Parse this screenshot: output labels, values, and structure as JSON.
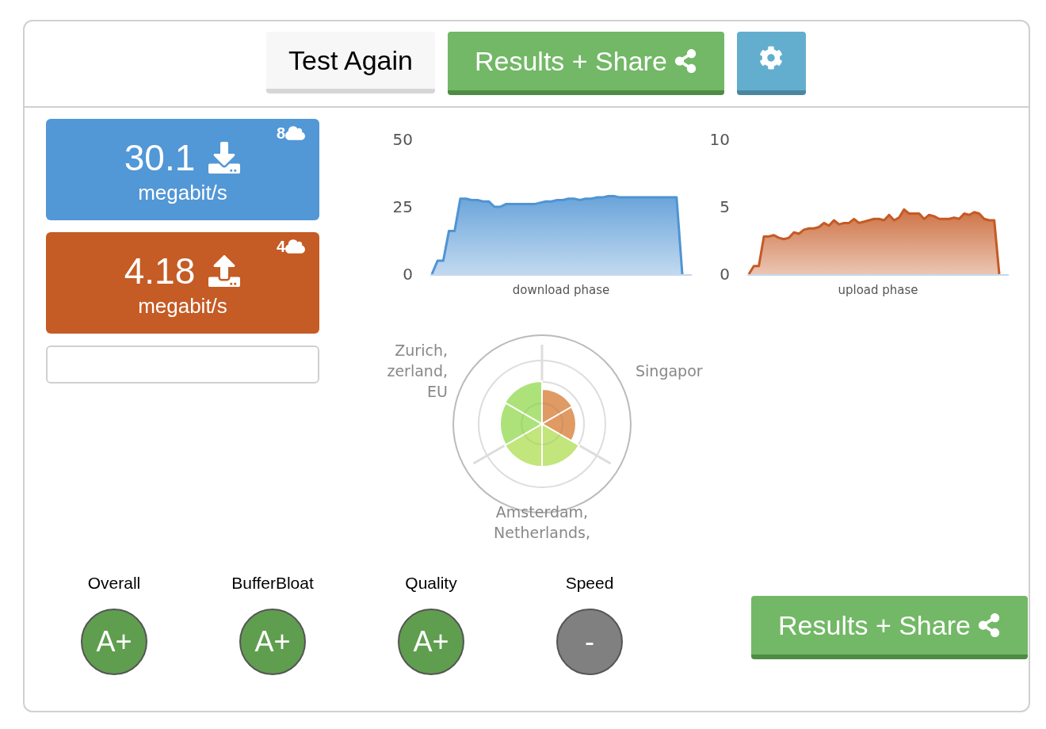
{
  "toolbar": {
    "buttons": [
      {
        "kind": "plain",
        "label": "Test Again"
      },
      {
        "kind": "share",
        "label": "Results + Share"
      },
      {
        "kind": "settings"
      }
    ]
  },
  "download": {
    "value": "30.1",
    "unit": "megabit/s",
    "servers": "8"
  },
  "upload": {
    "value": "4.18",
    "unit": "megabit/s",
    "servers": "4"
  },
  "charts": [
    {
      "chart_data": {
        "type": "area",
        "xlabel": "download phase",
        "ylim": [
          0,
          50
        ],
        "yticks": [
          0,
          25,
          50
        ],
        "series": [
          {
            "color": "#4f94d4",
            "values": [
              0,
              5,
              5,
              16,
              16,
              28,
              28,
              27.5,
              27.5,
              27,
              27,
              25,
              25,
              26,
              26,
              26,
              26,
              26,
              26,
              26.5,
              27,
              27,
              27.5,
              27.5,
              28,
              28,
              27.5,
              28,
              28,
              28.5,
              28.5,
              29,
              29,
              28.5,
              28.5,
              28.5,
              28.5,
              28.5,
              28.5,
              28.5,
              28.5,
              28.5,
              28.5,
              28.5,
              0
            ]
          }
        ]
      }
    },
    {
      "chart_data": {
        "type": "area",
        "xlabel": "upload phase",
        "ylim": [
          0,
          10
        ],
        "yticks": [
          0,
          5,
          10
        ],
        "series": [
          {
            "color": "#c55a24",
            "values": [
              0,
              0.6,
              0.6,
              2.8,
              2.8,
              2.9,
              2.7,
              2.6,
              2.7,
              3.1,
              3.0,
              3.3,
              3.4,
              3.4,
              3.5,
              3.8,
              3.6,
              4.0,
              3.7,
              3.8,
              3.8,
              4.1,
              3.8,
              3.9,
              4.0,
              4.1,
              4.1,
              4.0,
              4.4,
              4.0,
              4.2,
              4.8,
              4.5,
              4.5,
              4.5,
              4.1,
              4.4,
              4.3,
              4.1,
              4.1,
              4.1,
              4.2,
              4.1,
              4.5,
              4.4,
              4.6,
              4.5,
              4.1,
              4.0,
              4.0,
              0
            ]
          }
        ]
      }
    }
  ],
  "polar": {
    "labels": [
      {
        "kind": "left",
        "lines": [
          "Zurich,",
          "zerland,",
          "EU"
        ]
      },
      {
        "kind": "right",
        "lines": [
          "Singapor"
        ]
      },
      {
        "kind": "bottom",
        "lines": [
          "Amsterdam,",
          "Netherlands,"
        ]
      }
    ]
  },
  "grades": [
    {
      "label": "Overall",
      "grade": "A+",
      "color": "#5f9e4f"
    },
    {
      "label": "BufferBloat",
      "grade": "A+",
      "color": "#5f9e4f"
    },
    {
      "label": "Quality",
      "grade": "A+",
      "color": "#5f9e4f"
    },
    {
      "label": "Speed",
      "grade": "-",
      "color": "#808080"
    }
  ],
  "share_button": {
    "label": "Results + Share"
  }
}
